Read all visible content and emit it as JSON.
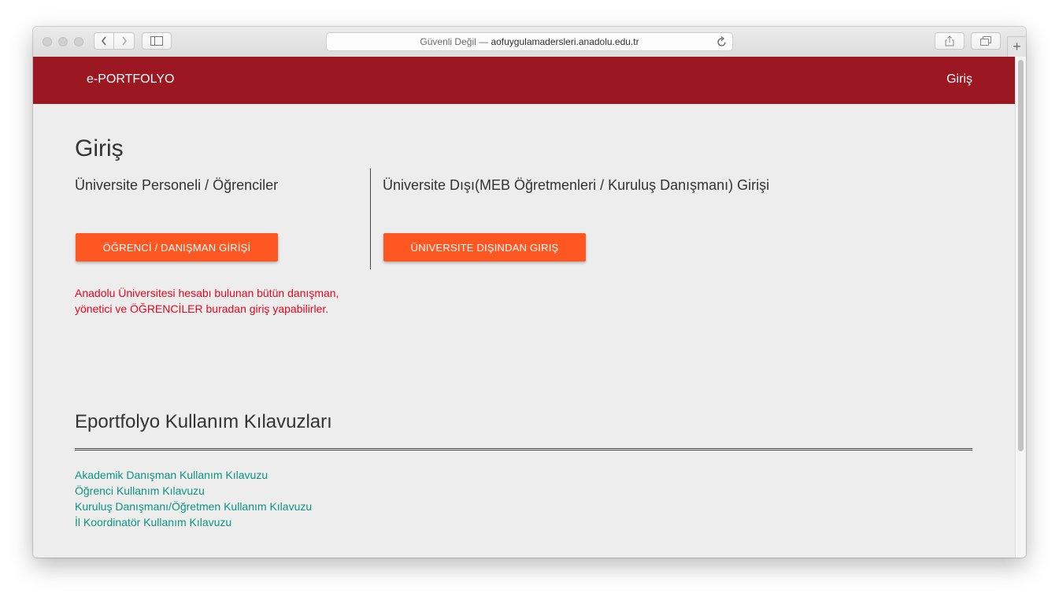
{
  "browser": {
    "address_prefix": "Güvenli Değil —",
    "address_domain": "aofuygulamadersleri.anadolu.edu.tr",
    "new_tab_label": "+"
  },
  "navbar": {
    "brand": "e-PORTFOLYO",
    "login_link": "Giriş",
    "bg_color": "#9b1722"
  },
  "login": {
    "title": "Giriş",
    "left_heading": "Üniversite Personeli / Öğrenciler",
    "left_button": "ÖĞRENCİ / DANIŞMAN GİRİŞİ",
    "right_heading": "Üniversite Dışı(MEB Öğretmenleri / Kuruluş Danışmanı) Girişi",
    "right_button": "ÜNIVERSITE DIŞINDAN GIRIŞ",
    "note_line1": "Anadolu Üniversitesi hesabı bulunan bütün danışman,",
    "note_line2": "yönetici ve ÖĞRENCİLER buradan giriş yapabilirler.",
    "button_color": "#fe5722",
    "note_color": "#e9051c"
  },
  "guides": {
    "title": "Eportfolyo Kullanım Kılavuzları",
    "link_color": "#0d9481",
    "links": [
      "Akademik Danışman Kullanım Kılavuzu",
      "Öğrenci Kullanım Kılavuzu",
      "Kuruluş Danışmanı/Öğretmen Kullanım Kılavuzu",
      "İl Koordinatör Kullanım Kılavuzu"
    ]
  },
  "icons": [
    "close-icon",
    "minimize-icon",
    "maximize-icon",
    "chevron-left-icon",
    "chevron-right-icon",
    "sidebar-icon",
    "reload-icon",
    "share-icon",
    "tabs-icon",
    "plus-icon"
  ]
}
